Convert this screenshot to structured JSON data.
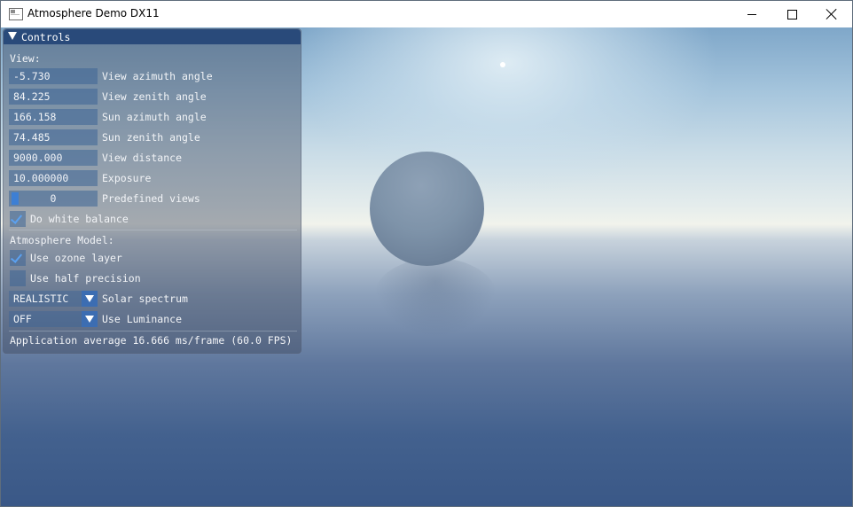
{
  "window": {
    "title": "Atmosphere Demo DX11"
  },
  "controls": {
    "title": "Controls",
    "view_heading": "View:",
    "fields": [
      {
        "value": "-5.730",
        "label": "View azimuth angle"
      },
      {
        "value": "84.225",
        "label": "View zenith angle"
      },
      {
        "value": "166.158",
        "label": "Sun azimuth angle"
      },
      {
        "value": "74.485",
        "label": "Sun zenith angle"
      },
      {
        "value": "9000.000",
        "label": "View distance"
      },
      {
        "value": "10.000000",
        "label": "Exposure"
      }
    ],
    "predefined_views": {
      "value": "0",
      "label": "Predefined views"
    },
    "white_balance": {
      "label": "Do white balance",
      "checked": true
    },
    "atmosphere_heading": "Atmosphere Model:",
    "ozone": {
      "label": "Use ozone layer",
      "checked": true
    },
    "half_precision": {
      "label": "Use half precision",
      "checked": false
    },
    "solar_spectrum": {
      "value": "REALISTIC",
      "label": "Solar spectrum"
    },
    "luminance": {
      "value": "OFF",
      "label": "Use Luminance"
    },
    "status": "Application average 16.666 ms/frame (60.0 FPS)"
  },
  "colors": {
    "header": "#294a7a",
    "accent": "#5ba1f0",
    "slider_grab": "#3d7fd4"
  }
}
